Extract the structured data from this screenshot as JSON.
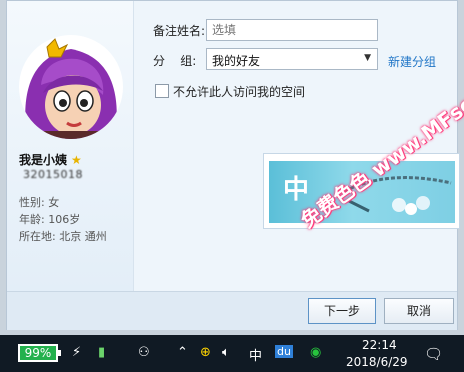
{
  "profile": {
    "nickname": "我是小姨",
    "qq_number": "32015018",
    "gender": "性别: 女",
    "age": "年龄: 106岁",
    "location": "所在地: 北京  通州"
  },
  "form": {
    "remark_label": "备注姓名:",
    "remark_placeholder": "选填",
    "group_label": "分    组:",
    "group_value": "我的好友",
    "new_group_link": "新建分组",
    "privacy_checkbox_label": "不允许此人访问我的空间"
  },
  "ad": {
    "text": "中"
  },
  "buttons": {
    "next": "下一步",
    "cancel": "取消"
  },
  "watermark": "免费色色 www.MFsese.com",
  "taskbar": {
    "battery_percent": "99%",
    "ime_label": "中",
    "baidu_label": "du",
    "time": "22:14",
    "date": "2018/6/29"
  },
  "colors": {
    "link": "#2176c7",
    "battery": "#23b14d",
    "star": "#e8b400"
  }
}
